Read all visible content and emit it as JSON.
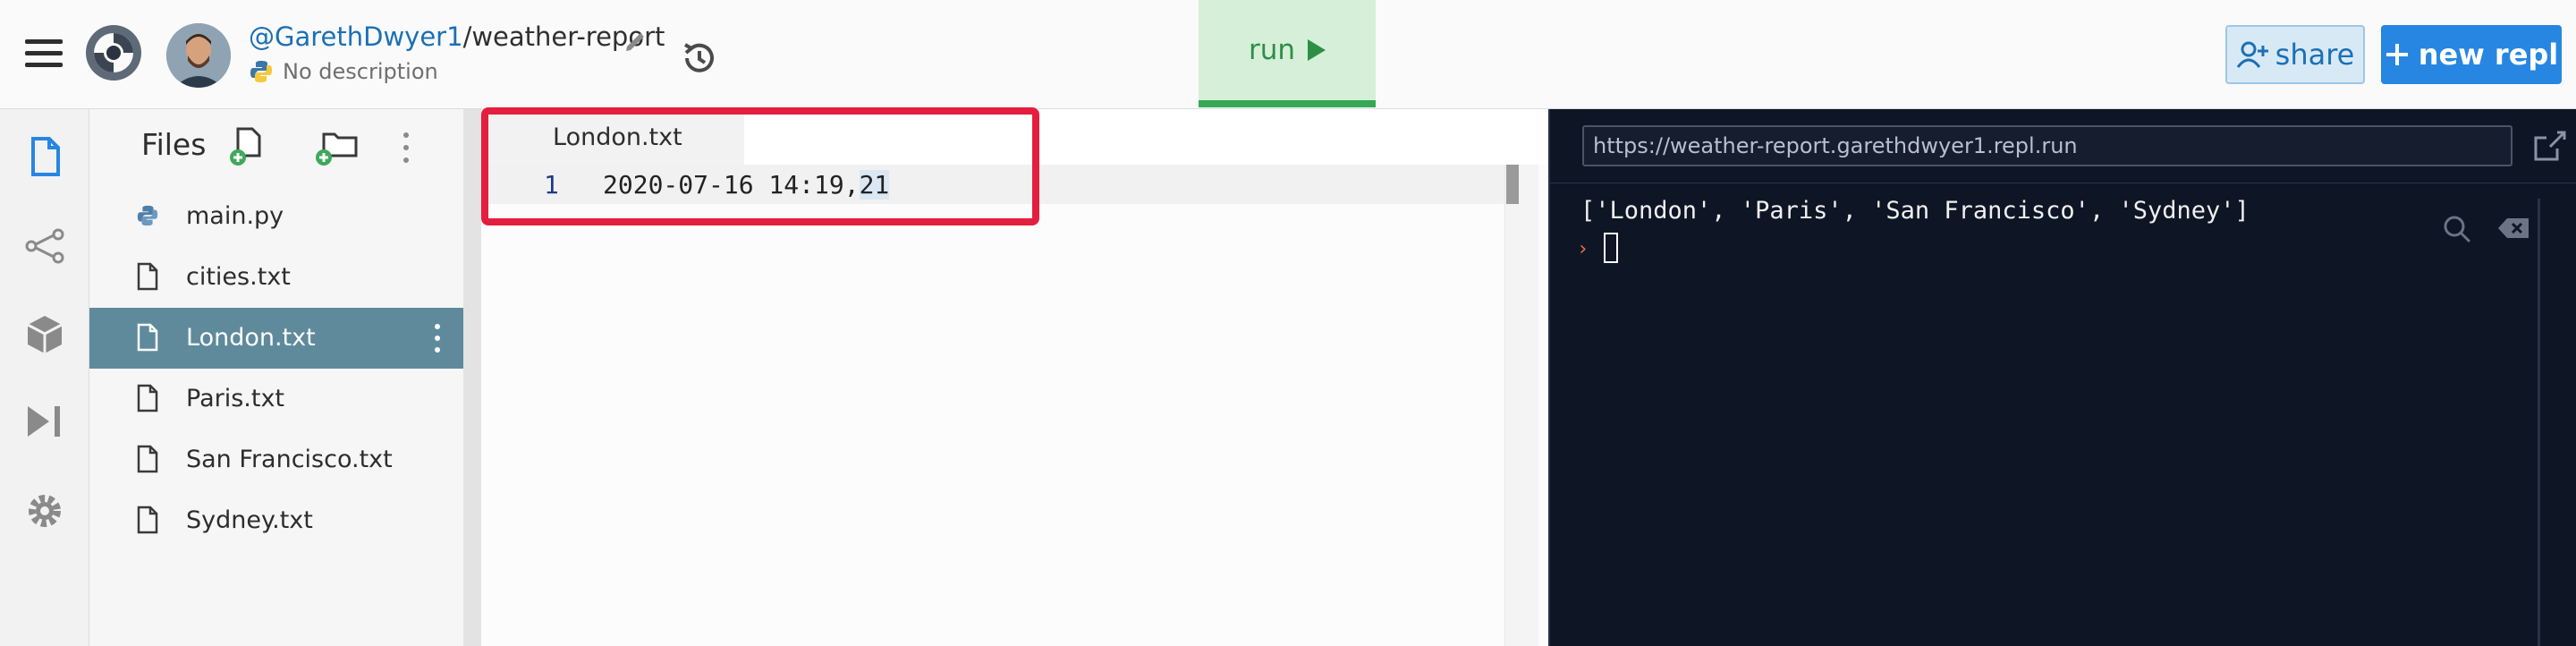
{
  "header": {
    "repl_owner": "@GarethDwyer1",
    "repl_separator": "/",
    "repl_name": "weather-report",
    "description": "No description",
    "run_label": "run",
    "share_label": "share",
    "new_repl_label": "new repl"
  },
  "files": {
    "title": "Files",
    "items": [
      {
        "name": "main.py",
        "icon": "python-icon"
      },
      {
        "name": "cities.txt",
        "icon": "file-icon"
      },
      {
        "name": "London.txt",
        "icon": "file-icon",
        "active": true
      },
      {
        "name": "Paris.txt",
        "icon": "file-icon"
      },
      {
        "name": "San Francisco.txt",
        "icon": "file-icon"
      },
      {
        "name": "Sydney.txt",
        "icon": "file-icon"
      }
    ]
  },
  "editor": {
    "tab_label": "London.txt",
    "line_number": "1",
    "code_main": "2020-07-16 14:19,",
    "code_selected": "21"
  },
  "console": {
    "url": "https://weather-report.garethdwyer1.repl.run",
    "output": "['London', 'Paris', 'San Francisco', 'Sydney']",
    "prompt": "›"
  },
  "colors": {
    "accent": "#2786e2",
    "run_green": "#34a853",
    "active_file": "#5f8a9c",
    "console_bg": "#0e1525",
    "highlight_box": "#e41e3f"
  }
}
